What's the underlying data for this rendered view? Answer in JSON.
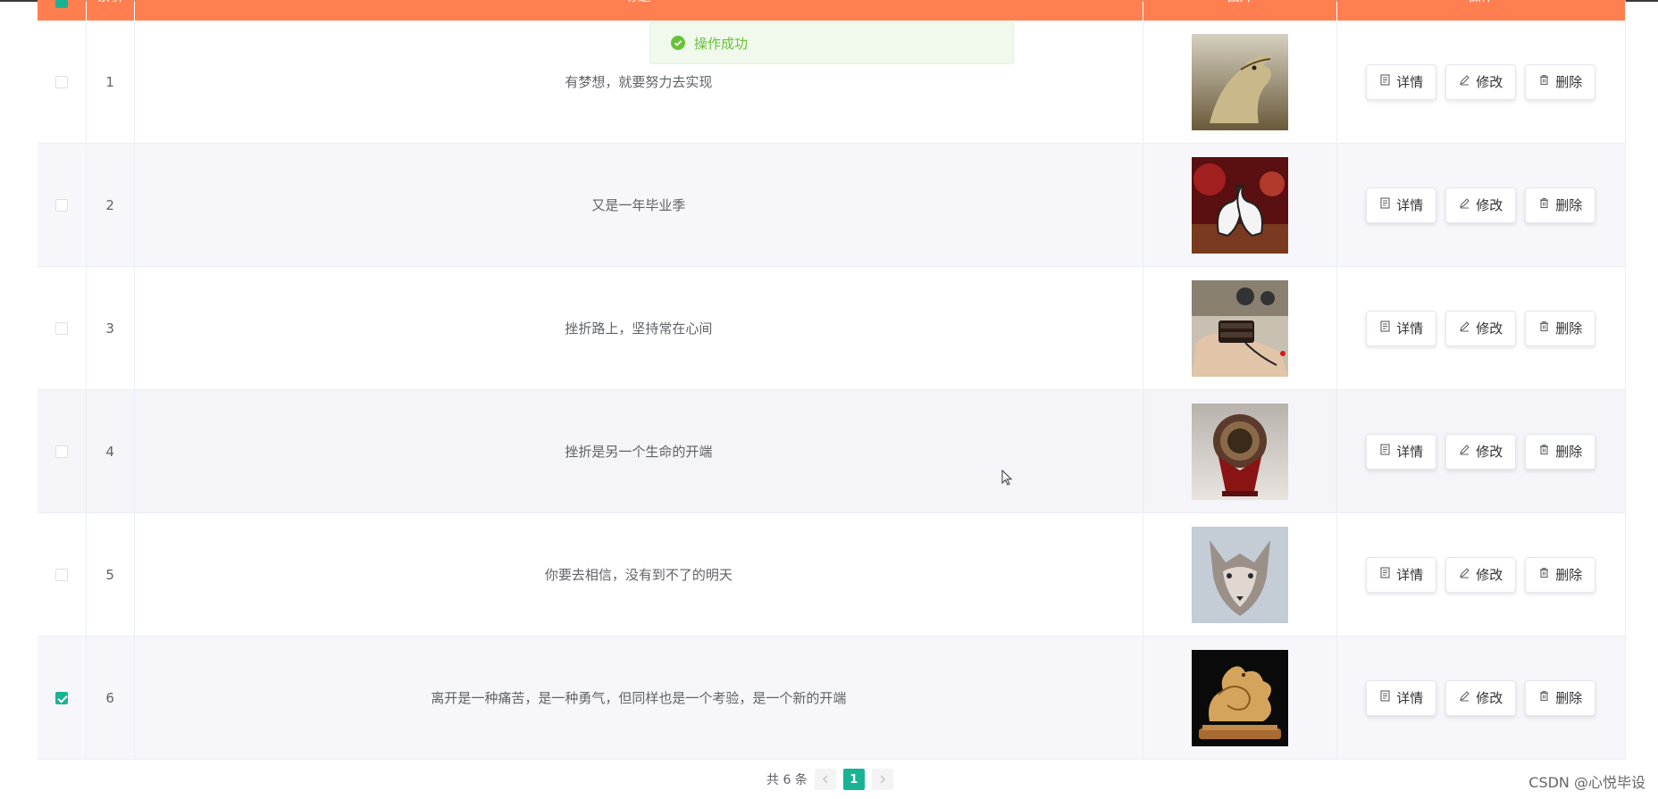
{
  "colors": {
    "header_bg": "#ff7f50",
    "accent": "#19b394",
    "toast_text": "#67c23a"
  },
  "table": {
    "headers": {
      "index": "索引",
      "title": "标题",
      "image": "图片",
      "ops": "操作"
    },
    "rows": [
      {
        "index": "1",
        "title": "有梦想，就要努力去实现",
        "image_icon": "eagle-sculpture-image",
        "checked": false
      },
      {
        "index": "2",
        "title": "又是一年毕业季",
        "image_icon": "swan-ornament-image",
        "checked": false
      },
      {
        "index": "3",
        "title": "挫折路上，坚持常在心间",
        "image_icon": "carved-block-image",
        "checked": false
      },
      {
        "index": "4",
        "title": "挫折是另一个生命的开端",
        "image_icon": "drum-ornament-image",
        "checked": false
      },
      {
        "index": "5",
        "title": "你要去相信，没有到不了的明天",
        "image_icon": "wolf-head-image",
        "checked": false
      },
      {
        "index": "6",
        "title": "离开是一种痛苦，是一种勇气，但同样也是一个考验，是一个新的开端",
        "image_icon": "golden-dragon-image",
        "checked": true
      }
    ],
    "actions": {
      "detail": "详情",
      "edit": "修改",
      "delete": "删除"
    }
  },
  "toast": {
    "message": "操作成功",
    "icon": "check-circle-icon"
  },
  "pagination": {
    "total_label": "共 6 条",
    "current_page": "1",
    "prev_icon": "chevron-left-icon",
    "next_icon": "chevron-right-icon"
  },
  "watermark": "CSDN @心悦毕设"
}
